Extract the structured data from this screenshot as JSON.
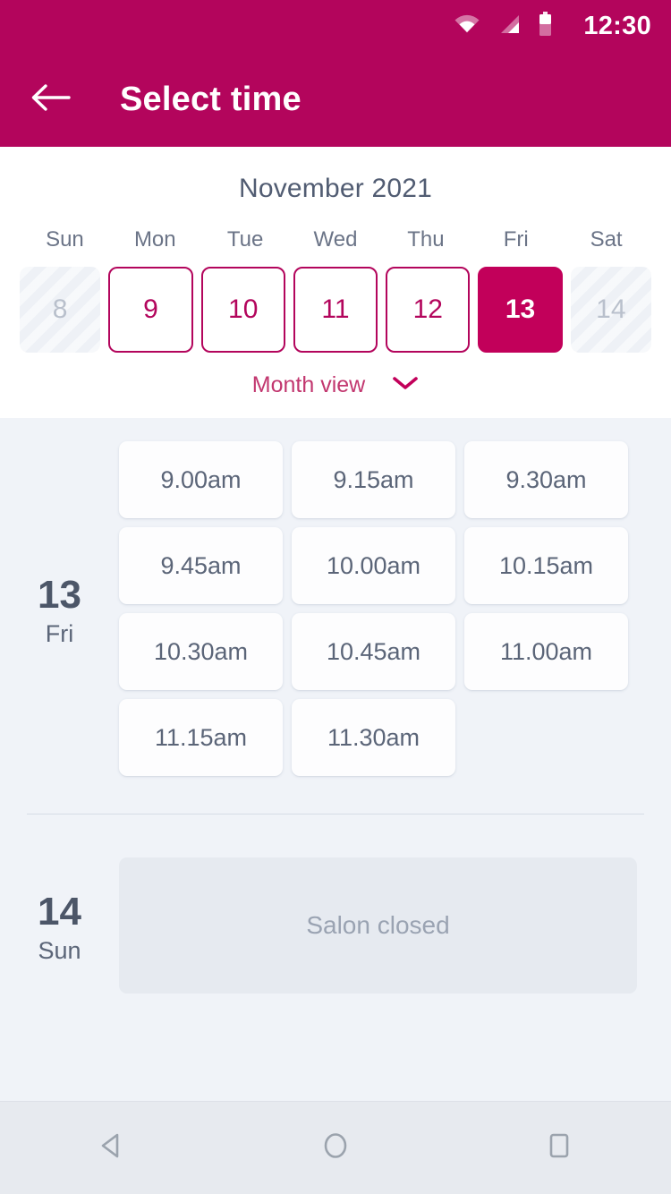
{
  "status_bar": {
    "time": "12:30",
    "icons": [
      "wifi-icon",
      "signal-icon",
      "battery-icon"
    ]
  },
  "app_bar": {
    "title": "Select time",
    "back_icon": "arrow-left-icon"
  },
  "calendar": {
    "month_title": "November 2021",
    "weekdays": [
      "Sun",
      "Mon",
      "Tue",
      "Wed",
      "Thu",
      "Fri",
      "Sat"
    ],
    "days": [
      {
        "number": "8",
        "state": "disabled"
      },
      {
        "number": "9",
        "state": "available"
      },
      {
        "number": "10",
        "state": "available"
      },
      {
        "number": "11",
        "state": "available"
      },
      {
        "number": "12",
        "state": "available"
      },
      {
        "number": "13",
        "state": "selected"
      },
      {
        "number": "14",
        "state": "disabled"
      }
    ],
    "month_view_label": "Month view",
    "month_view_icon": "chevron-down-icon"
  },
  "schedule": [
    {
      "day_number": "13",
      "day_name": "Fri",
      "slots": [
        "9.00am",
        "9.15am",
        "9.30am",
        "9.45am",
        "10.00am",
        "10.15am",
        "10.30am",
        "10.45am",
        "11.00am",
        "11.15am",
        "11.30am"
      ]
    },
    {
      "day_number": "14",
      "day_name": "Sun",
      "closed_label": "Salon closed"
    }
  ],
  "nav_bar": {
    "back_icon": "triangle-back-icon",
    "home_icon": "circle-home-icon",
    "recents_icon": "square-recents-icon"
  },
  "colors": {
    "brand": "#b3055c",
    "brand_selected": "#c2005a",
    "brand_link": "#c2376f",
    "text_dark": "#4c5668",
    "text_muted": "#5b6578",
    "bg_content": "#f0f3f8",
    "bg_card": "#fdfdfe",
    "bg_disabled": "#e6eaf0",
    "nav_bg": "#e7eaef"
  }
}
